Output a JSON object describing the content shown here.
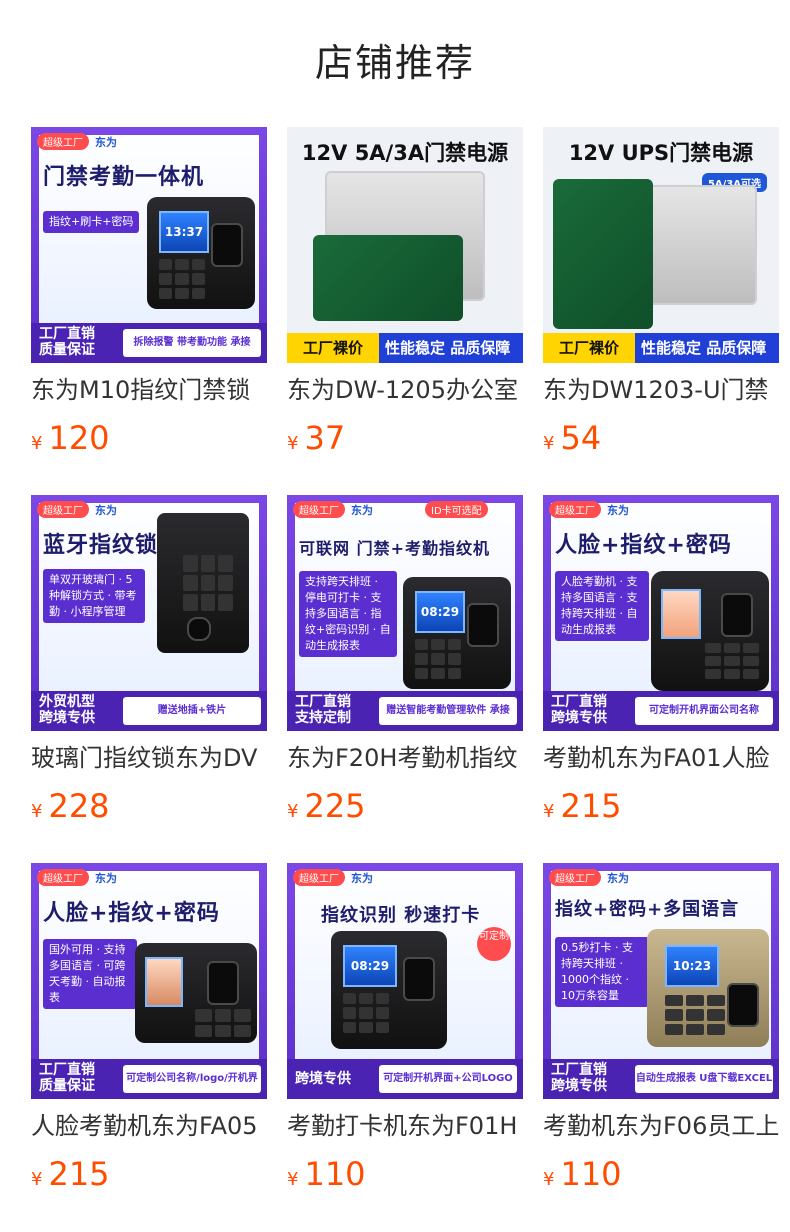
{
  "page": {
    "title": "店铺推荐"
  },
  "products": [
    {
      "title": "东为M10指纹门禁锁",
      "currency": "¥",
      "price": "120",
      "thumb": {
        "badge": "超级工厂",
        "brand": "东为",
        "headline": "门禁考勤一体机",
        "subtext": "指纹+刷卡+密码",
        "screen_time": "13:37",
        "bottom_left_1": "工厂直销",
        "bottom_left_2": "质量保证",
        "bottom_right": "拆除报警 带考勤功能 承接OEM/ODM贴牌加工"
      }
    },
    {
      "title": "东为DW-1205办公室",
      "currency": "¥",
      "price": "37",
      "thumb": {
        "headline": "12V 5A/3A门禁电源",
        "left_band": "工厂裸价",
        "right_band": "性能稳定 品质保障"
      }
    },
    {
      "title": "东为DW1203-U门禁",
      "currency": "¥",
      "price": "54",
      "thumb": {
        "headline": "12V UPS门禁电源",
        "tag": "5A/3A可选",
        "left_band": "工厂裸价",
        "right_band": "性能稳定 品质保障"
      }
    },
    {
      "title": "玻璃门指纹锁东为DV",
      "currency": "¥",
      "price": "228",
      "thumb": {
        "badge": "超级工厂",
        "brand": "东为",
        "headline": "蓝牙指纹锁",
        "subtext": "单双开玻璃门 · 5种解锁方式 · 带考勤 · 小程序管理",
        "bottom_left_1": "外贸机型",
        "bottom_left_2": "跨境专供",
        "bottom_right": "赠送地插+铁片"
      }
    },
    {
      "title": "东为F20H考勤机指纹",
      "currency": "¥",
      "price": "225",
      "thumb": {
        "badge": "超级工厂",
        "brand": "东为",
        "headline": "可联网 门禁+考勤指纹机",
        "tag": "ID卡可选配",
        "subtext": "支持跨天排班 · 停电可打卡 · 支持多国语言 · 指纹+密码识别 · 自动生成报表",
        "screen_time": "08:29",
        "bottom_left_1": "工厂直销",
        "bottom_left_2": "支持定制",
        "bottom_right": "赠送智能考勤管理软件 承接OEM/ODM贴牌加工"
      }
    },
    {
      "title": "考勤机东为FA01人脸",
      "currency": "¥",
      "price": "215",
      "thumb": {
        "badge": "超级工厂",
        "brand": "东为",
        "headline": "人脸+指纹+密码",
        "subtext": "人脸考勤机 · 支持多国语言 · 支持跨天排班 · 自动生成报表",
        "bottom_left_1": "工厂直销",
        "bottom_left_2": "跨境专供",
        "bottom_right": "可定制开机界面公司名称LOGO 承接OEM/ODM贴牌加工"
      }
    },
    {
      "title": "人脸考勤机东为FA05",
      "currency": "¥",
      "price": "215",
      "thumb": {
        "badge": "超级工厂",
        "brand": "东为",
        "headline": "人脸+指纹+密码",
        "subtext": "国外可用 · 支持多国语言 · 可跨天考勤 · 自动报表",
        "bottom_left_1": "工厂直销",
        "bottom_left_2": "质量保证",
        "bottom_right": "可定制公司名称/logo/开机界面 承接OEM/ODM贴牌加工"
      }
    },
    {
      "title": "考勤打卡机东为F01H",
      "currency": "¥",
      "price": "110",
      "thumb": {
        "badge": "超级工厂",
        "brand": "东为",
        "headline": "指纹识别 秒速打卡",
        "tag": "可定制",
        "screen_time": "08:29",
        "bottom_left_1": "跨境专供",
        "bottom_right": "可定制开机界面+公司LOGO"
      }
    },
    {
      "title": "考勤机东为F06员工上",
      "currency": "¥",
      "price": "110",
      "thumb": {
        "badge": "超级工厂",
        "brand": "东为",
        "headline": "指纹+密码+多国语言",
        "subtext": "0.5秒打卡 · 支持跨天排班 · 1000个指纹 · 10万条容量",
        "screen_time": "10:23",
        "bottom_left_1": "工厂直销",
        "bottom_left_2": "跨境专供",
        "bottom_right": "自动生成报表 U盘下载EXCEL表 承接OEM/ODM贴牌加工"
      }
    }
  ],
  "colors": {
    "price": "#ff4d00",
    "frame_purple": "#5a2fc7",
    "band_blue": "#1f3fd6",
    "band_yellow": "#ffd400"
  }
}
